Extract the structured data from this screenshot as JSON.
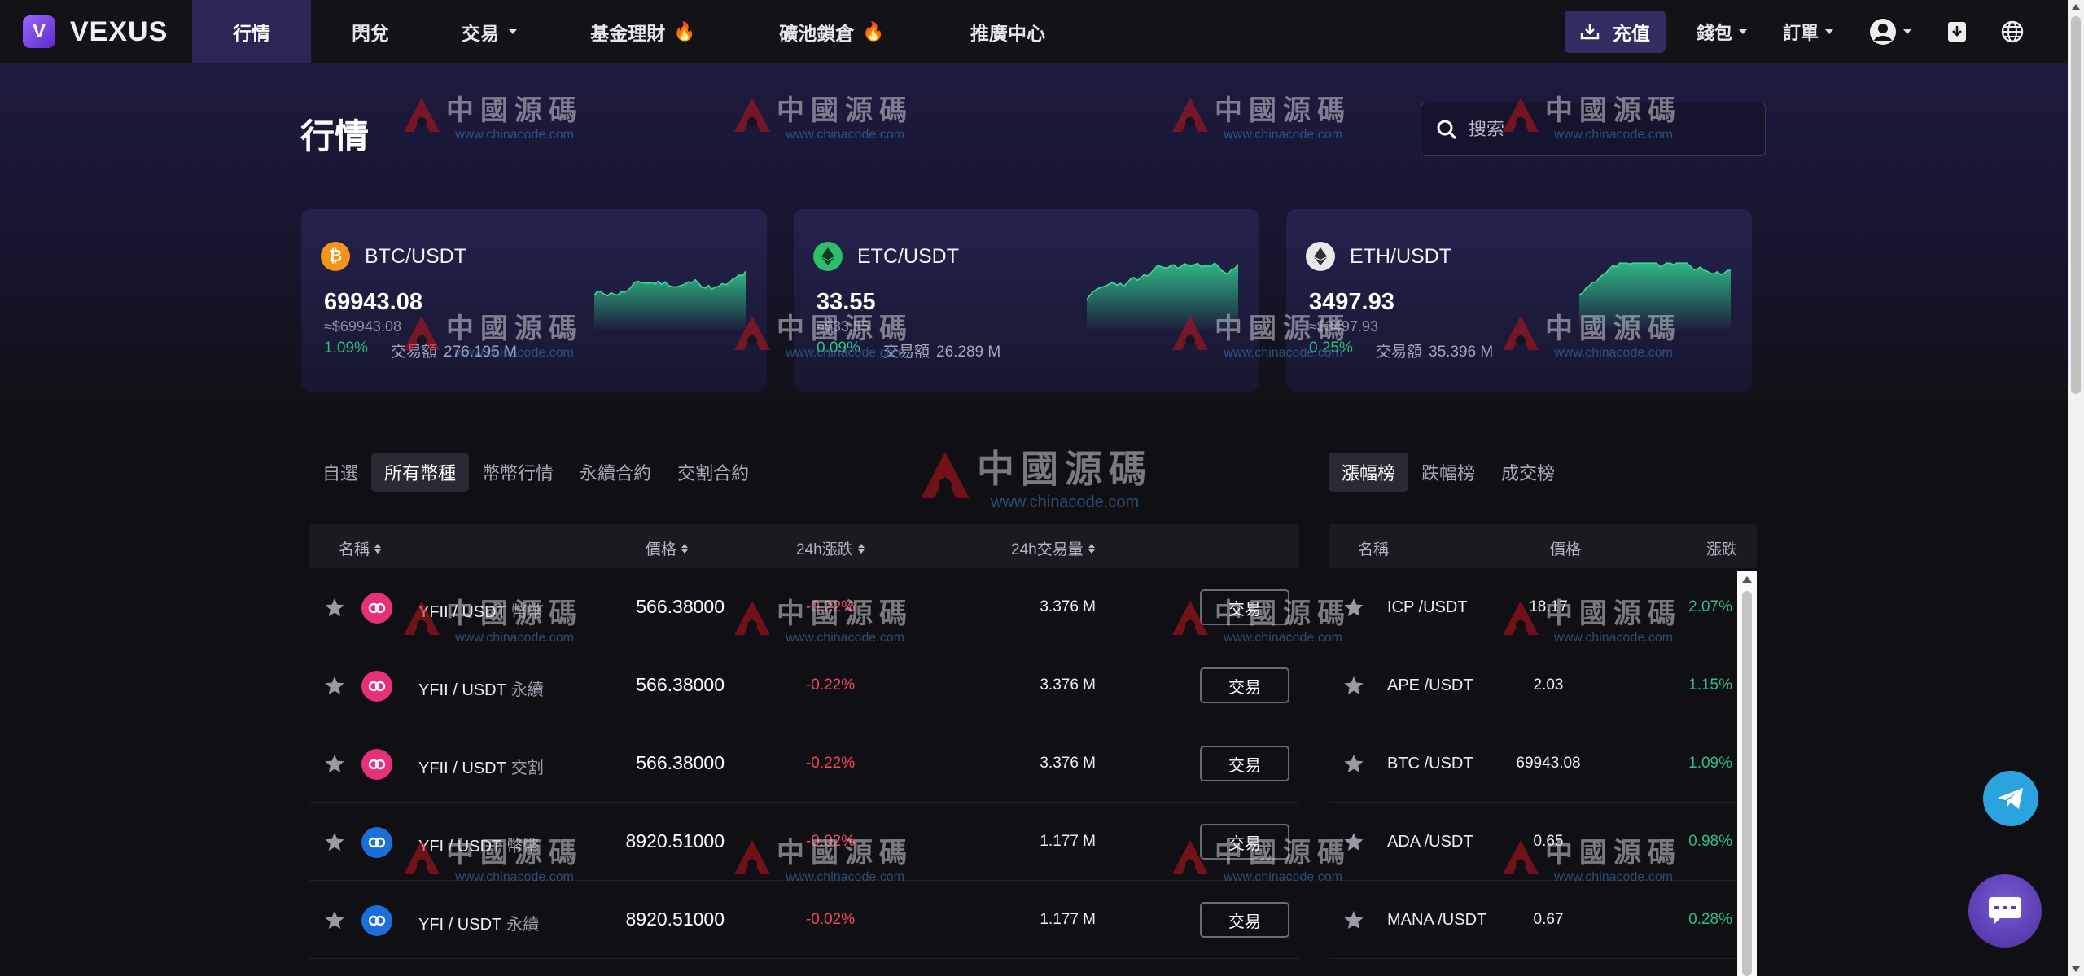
{
  "brand": {
    "name": "VEXUS",
    "logo_letter": "V"
  },
  "nav": {
    "items": [
      {
        "label": "行情",
        "active": true,
        "dropdown": false,
        "flame": false
      },
      {
        "label": "閃兌",
        "active": false,
        "dropdown": false,
        "flame": false
      },
      {
        "label": "交易",
        "active": false,
        "dropdown": true,
        "flame": false
      },
      {
        "label": "基金理財",
        "active": false,
        "dropdown": false,
        "flame": true
      },
      {
        "label": "礦池鎖倉",
        "active": false,
        "dropdown": false,
        "flame": true
      },
      {
        "label": "推廣中心",
        "active": false,
        "dropdown": false,
        "flame": false
      }
    ],
    "deposit_label": "充值",
    "wallet_label": "錢包",
    "orders_label": "訂單"
  },
  "hero": {
    "title": "行情",
    "search_placeholder": "搜索",
    "cards": [
      {
        "pair": "BTC/USDT",
        "price": "69943.08",
        "usd": "≈$69943.08",
        "change": "1.09%",
        "volume_label": "交易額",
        "volume": "276.195 M",
        "icon_letter": "₿",
        "icon_color": "#f7931a",
        "icon": "bitcoin-icon"
      },
      {
        "pair": "ETC/USDT",
        "price": "33.55",
        "usd": "≈$33.55",
        "change": "0.09%",
        "volume_label": "交易額",
        "volume": "26.289 M",
        "icon_letter": "◆",
        "icon_color": "#2ebd6a",
        "icon": "ethereum-classic-icon"
      },
      {
        "pair": "ETH/USDT",
        "price": "3497.93",
        "usd": "≈$3497.93",
        "change": "0.25%",
        "volume_label": "交易額",
        "volume": "35.396 M",
        "icon_letter": "◆",
        "icon_color": "#e8e8ee",
        "icon": "ethereum-icon"
      }
    ]
  },
  "tabs_left": [
    {
      "label": "自選",
      "active": false
    },
    {
      "label": "所有幣種",
      "active": true
    },
    {
      "label": "幣幣行情",
      "active": false
    },
    {
      "label": "永續合約",
      "active": false
    },
    {
      "label": "交割合約",
      "active": false
    }
  ],
  "tabs_right": [
    {
      "label": "漲幅榜",
      "active": true
    },
    {
      "label": "跌幅榜",
      "active": false
    },
    {
      "label": "成交榜",
      "active": false
    }
  ],
  "main_table": {
    "headers": {
      "name": "名稱",
      "price": "價格",
      "change": "24h漲跌",
      "volume": "24h交易量"
    },
    "rows": [
      {
        "pair": "YFII / USDT",
        "type": "幣幣",
        "price": "566.38000",
        "change": "-0.22%",
        "volume": "3.376 M",
        "action": "交易",
        "coin_color": "#e6317a",
        "icon": "yfii-icon"
      },
      {
        "pair": "YFII / USDT",
        "type": "永續",
        "price": "566.38000",
        "change": "-0.22%",
        "volume": "3.376 M",
        "action": "交易",
        "coin_color": "#e6317a",
        "icon": "yfii-icon"
      },
      {
        "pair": "YFII / USDT",
        "type": "交割",
        "price": "566.38000",
        "change": "-0.22%",
        "volume": "3.376 M",
        "action": "交易",
        "coin_color": "#e6317a",
        "icon": "yfii-icon"
      },
      {
        "pair": "YFI / USDT",
        "type": "幣幣",
        "price": "8920.51000",
        "change": "-0.02%",
        "volume": "1.177 M",
        "action": "交易",
        "coin_color": "#1a6fd8",
        "icon": "yfi-icon"
      },
      {
        "pair": "YFI / USDT",
        "type": "永續",
        "price": "8920.51000",
        "change": "-0.02%",
        "volume": "1.177 M",
        "action": "交易",
        "coin_color": "#1a6fd8",
        "icon": "yfi-icon"
      }
    ]
  },
  "side_table": {
    "headers": {
      "name": "名稱",
      "price": "價格",
      "change": "漲跌"
    },
    "rows": [
      {
        "pair": "ICP /USDT",
        "price": "18.17",
        "change": "2.07%"
      },
      {
        "pair": "APE /USDT",
        "price": "2.03",
        "change": "1.15%"
      },
      {
        "pair": "BTC /USDT",
        "price": "69943.08",
        "change": "1.09%"
      },
      {
        "pair": "ADA /USDT",
        "price": "0.65",
        "change": "0.98%"
      },
      {
        "pair": "MANA /USDT",
        "price": "0.67",
        "change": "0.28%"
      }
    ]
  },
  "watermark": {
    "text": "中國源碼",
    "url": "www.chinacode.com"
  },
  "colors": {
    "up": "#2ebd85",
    "down": "#f6465d",
    "accent": "#2b2656"
  }
}
